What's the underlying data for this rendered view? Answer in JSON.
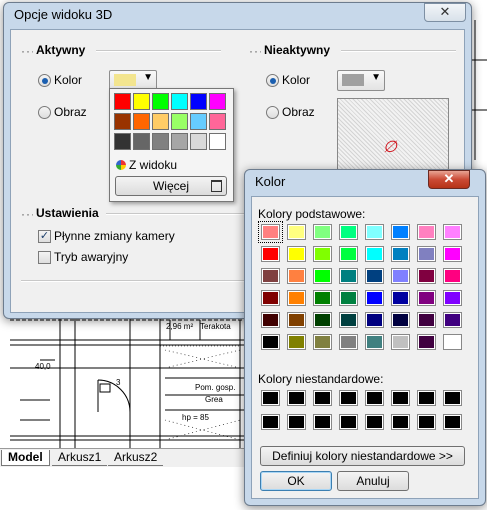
{
  "background": {
    "tabs": [
      "Model",
      "Arkusz1",
      "Arkusz2"
    ],
    "drawing_texts": [
      "2,96 m²",
      "Terakota",
      "Pom. gosp.",
      "Grea",
      "hp = 85",
      "40,0",
      "3"
    ]
  },
  "options_dialog": {
    "title": "Opcje widoku 3D",
    "close_label": "✕",
    "active_group": "Aktywny",
    "inactive_group": "Nieaktywny",
    "radio_color": "Kolor",
    "radio_image": "Obraz",
    "inactive_radio_color": "Kolor",
    "inactive_radio_image": "Obraz",
    "settings_group": "Ustawienia",
    "smooth_camera": "Płynne zmiany kamery",
    "safe_mode": "Tryb awaryjny",
    "active_color": "#f3e58f",
    "inactive_color": "#a0a0a0",
    "no_image_symbol": "∅"
  },
  "color_dropdown": {
    "colors": [
      [
        "#ff0000",
        "#ffff00",
        "#00ff00",
        "#00ffff",
        "#0000ff",
        "#ff00ff"
      ],
      [
        "#993300",
        "#ff6600",
        "#ffcc66",
        "#99ff66",
        "#66ccff",
        "#ff6699"
      ],
      [
        "#333333",
        "#666666",
        "#808080",
        "#a6a6a6",
        "#d9d9d9",
        "#ffffff"
      ]
    ],
    "from_view_label": "Z widoku",
    "more_label": "Więcej"
  },
  "color_dialog": {
    "title": "Kolor",
    "close_label": "✕",
    "basic_colors_label": "Kolory podstawowe:",
    "custom_colors_label": "Kolory niestandardowe:",
    "define_label": "Definiuj kolory niestandardowe >>",
    "ok_label": "OK",
    "cancel_label": "Anuluj",
    "basic_colors": [
      [
        "#ff8080",
        "#ffff80",
        "#80ff80",
        "#00ff80",
        "#80ffff",
        "#0080ff",
        "#ff80c0",
        "#ff80ff"
      ],
      [
        "#ff0000",
        "#ffff00",
        "#80ff00",
        "#00ff40",
        "#00ffff",
        "#0080c0",
        "#8080c0",
        "#ff00ff"
      ],
      [
        "#804040",
        "#ff8040",
        "#00ff00",
        "#008080",
        "#004080",
        "#8080ff",
        "#800040",
        "#ff0080"
      ],
      [
        "#800000",
        "#ff8000",
        "#008000",
        "#008040",
        "#0000ff",
        "#0000a0",
        "#800080",
        "#8000ff"
      ],
      [
        "#400000",
        "#804000",
        "#004000",
        "#004040",
        "#000080",
        "#000040",
        "#400040",
        "#400080"
      ],
      [
        "#000000",
        "#808000",
        "#808040",
        "#808080",
        "#408080",
        "#c0c0c0",
        "#400040",
        "#ffffff"
      ]
    ],
    "custom_colors": [
      [
        "#000000",
        "#000000",
        "#000000",
        "#000000",
        "#000000",
        "#000000",
        "#000000",
        "#000000"
      ],
      [
        "#000000",
        "#000000",
        "#000000",
        "#000000",
        "#000000",
        "#000000",
        "#000000",
        "#000000"
      ]
    ]
  }
}
